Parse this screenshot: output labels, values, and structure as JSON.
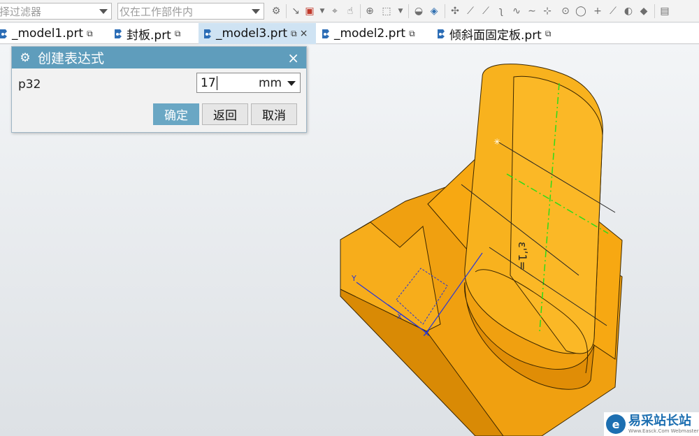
{
  "toolbar": {
    "filter_value": "择过滤器",
    "scope_value": "仅在工作部件内"
  },
  "tabs": [
    {
      "label": "_model1.prt",
      "icon": "part-file-icon"
    },
    {
      "label": "封板.prt",
      "icon": "part-file-icon"
    },
    {
      "label": "_model3.prt",
      "icon": "part-file-icon",
      "active": true
    },
    {
      "label": "_model2.prt",
      "icon": "part-file-icon"
    },
    {
      "label": "倾斜面固定板.prt",
      "icon": "part-file-icon"
    }
  ],
  "dialog": {
    "title": "创建表达式",
    "name": "p32",
    "value": "17",
    "unit": "mm",
    "ok": "确定",
    "back": "返回",
    "cancel": "取消"
  },
  "viewport": {
    "dimension_text": "ε'ʹ1=",
    "axis_y": "Y",
    "axis_x": "X",
    "model_color": "#f3a30f"
  },
  "watermark": {
    "text": "易采站长站",
    "sub": "Www.Easck.Com  Webmaster"
  },
  "colors": {
    "dialog_title_bg": "#5f9dbc",
    "primary_button": "#6aa7c4",
    "active_tab": "#cfe3f3"
  }
}
